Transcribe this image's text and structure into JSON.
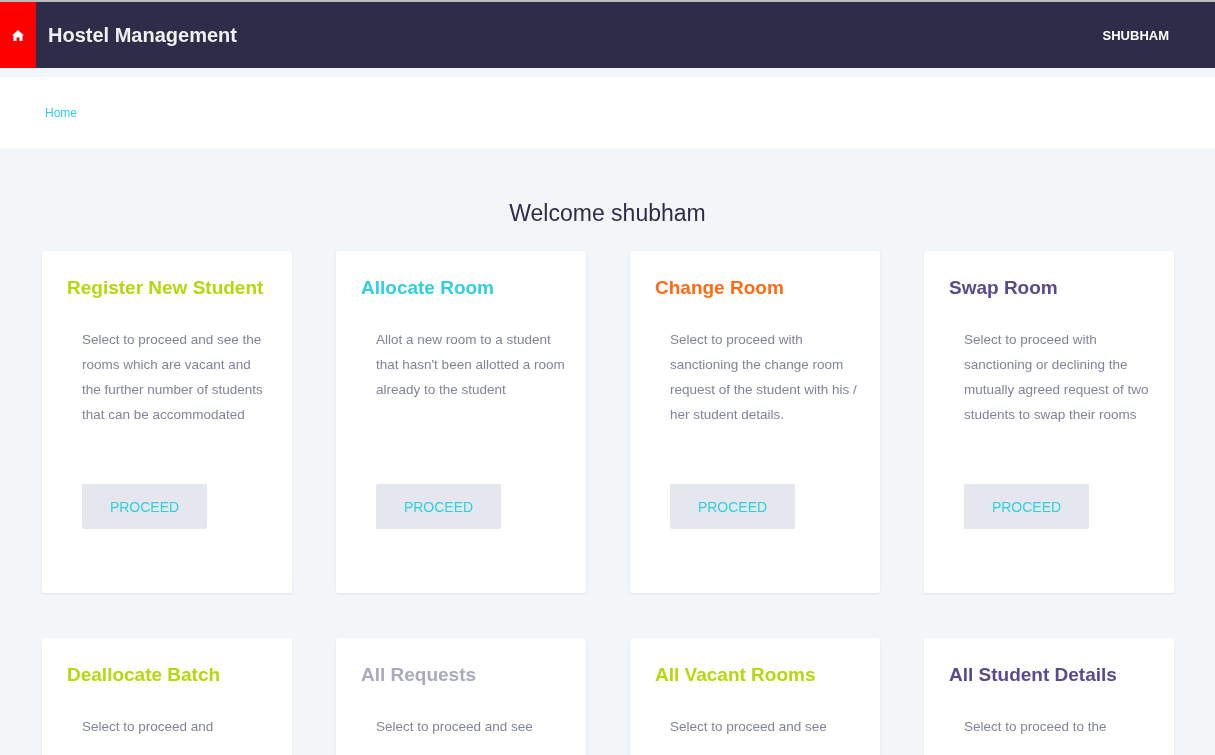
{
  "navbar": {
    "title": "Hostel Management",
    "user": "SHUBHAM"
  },
  "breadcrumb": [
    "Home"
  ],
  "welcome": "Welcome shubham",
  "cards": [
    {
      "title": "Register New Student",
      "color": "#b5d70c",
      "description": "Select to proceed and see the rooms which are vacant and the further number of students that can be accommodated",
      "button": "PROCEED"
    },
    {
      "title": "Allocate Room",
      "color": "#2fcfe0",
      "description": "Allot a new room to a student that hasn't been allotted a room already to the student",
      "button": "PROCEED"
    },
    {
      "title": "Change Room",
      "color": "#ff6a13",
      "description": "Select to proceed with sanctioning the change room request of the student with his / her student details.",
      "button": "PROCEED"
    },
    {
      "title": "Swap Room",
      "color": "#5b4a8b",
      "description": "Select to proceed with sanctioning or declining the mutually agreed request of two students to swap their rooms",
      "button": "PROCEED"
    },
    {
      "title": "Deallocate Batch",
      "color": "#b5d70c",
      "description": "Select to proceed and"
    },
    {
      "title": "All Requests",
      "color": "#a8abbe",
      "description": "Select to proceed and see"
    },
    {
      "title": "All Vacant Rooms",
      "color": "#b5d70c",
      "description": "Select to proceed and see"
    },
    {
      "title": "All Student Details",
      "color": "#5b4a8b",
      "description": "Select to proceed to the"
    }
  ]
}
